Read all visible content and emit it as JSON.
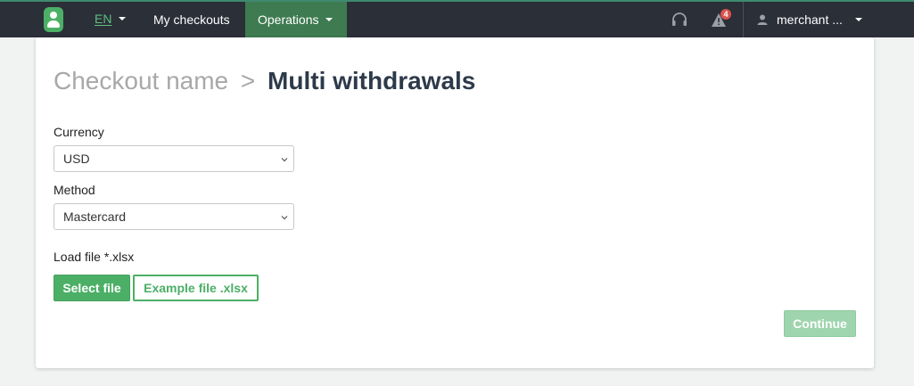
{
  "nav": {
    "language": "EN",
    "my_checkouts": "My checkouts",
    "operations": "Operations",
    "alert_count": "4",
    "user": "merchant ..."
  },
  "page": {
    "breadcrumb": "Checkout name",
    "separator": ">",
    "title": "Multi withdrawals"
  },
  "form": {
    "currency_label": "Currency",
    "currency_value": "USD",
    "method_label": "Method",
    "method_value": "Mastercard",
    "file_label": "Load file *.xlsx",
    "select_file": "Select file",
    "example_file": "Example file .xlsx",
    "continue": "Continue"
  },
  "colors": {
    "accent": "#4caf66",
    "nav_bg": "#2b2f38",
    "nav_active": "#3e7b51",
    "badge": "#d9534f"
  },
  "icons": {
    "logo": "user-shield-logo",
    "headset": "headset-icon",
    "alert": "warning-triangle-icon",
    "user": "user-icon"
  }
}
